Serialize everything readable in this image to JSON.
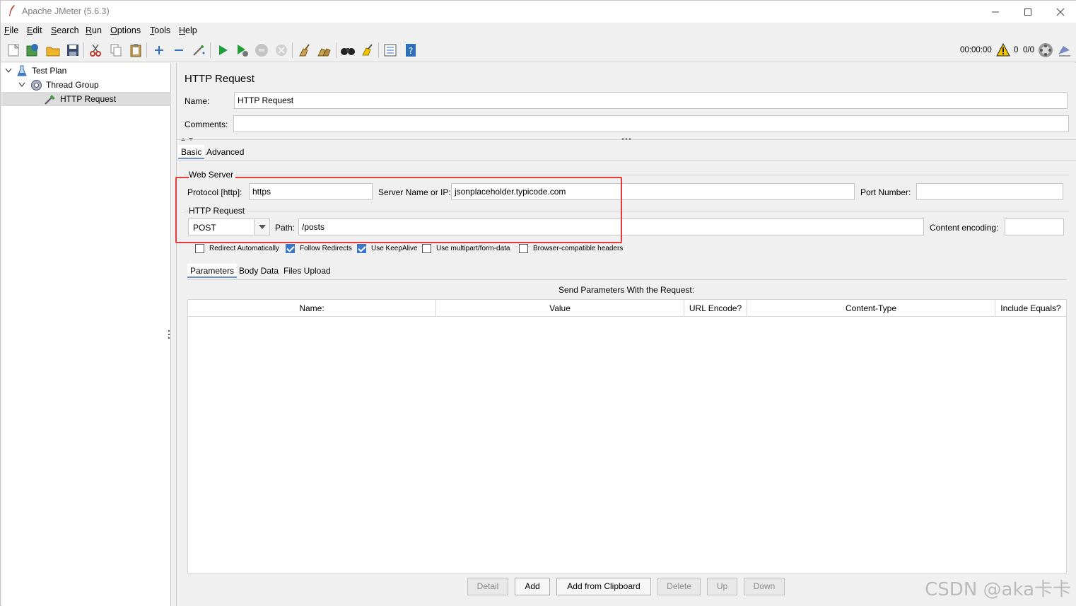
{
  "window": {
    "title": "Apache JMeter (5.6.3)"
  },
  "menu": [
    "File",
    "Edit",
    "Search",
    "Run",
    "Options",
    "Tools",
    "Help"
  ],
  "menu_mnemonics": [
    "F",
    "E",
    "S",
    "R",
    "O",
    "T",
    "H"
  ],
  "status": {
    "timer": "00:00:00",
    "warnings": "0",
    "threads": "0/0"
  },
  "tree": {
    "items": [
      {
        "label": "Test Plan",
        "icon": "beaker-icon"
      },
      {
        "label": "Thread Group",
        "icon": "gear-icon"
      },
      {
        "label": "HTTP Request",
        "icon": "pipette-icon"
      }
    ]
  },
  "panel": {
    "title": "HTTP Request",
    "name_label": "Name:",
    "name_value": "HTTP Request",
    "comments_label": "Comments:",
    "comments_value": "",
    "tabs": [
      "Basic",
      "Advanced"
    ],
    "web_server": {
      "legend": "Web Server",
      "protocol_label": "Protocol [http]:",
      "protocol_value": "https",
      "server_label": "Server Name or IP:",
      "server_value": "jsonplaceholder.typicode.com",
      "port_label": "Port Number:",
      "port_value": ""
    },
    "http_request": {
      "legend": "HTTP Request",
      "method": "POST",
      "path_label": "Path:",
      "path_value": "/posts",
      "encoding_label": "Content encoding:",
      "encoding_value": ""
    },
    "checkboxes": [
      {
        "label": "Redirect Automatically",
        "checked": false
      },
      {
        "label": "Follow Redirects",
        "checked": true
      },
      {
        "label": "Use KeepAlive",
        "checked": true
      },
      {
        "label": "Use multipart/form-data",
        "checked": false
      },
      {
        "label": "Browser-compatible headers",
        "checked": false
      }
    ],
    "subtabs": [
      "Parameters",
      "Body Data",
      "Files Upload"
    ],
    "params_caption": "Send Parameters With the Request:",
    "columns": [
      "Name:",
      "Value",
      "URL Encode?",
      "Content-Type",
      "Include Equals?"
    ],
    "buttons": [
      {
        "label": "Detail",
        "enabled": false
      },
      {
        "label": "Add",
        "enabled": true
      },
      {
        "label": "Add from Clipboard",
        "enabled": true
      },
      {
        "label": "Delete",
        "enabled": false
      },
      {
        "label": "Up",
        "enabled": false
      },
      {
        "label": "Down",
        "enabled": false
      }
    ]
  },
  "watermark": "CSDN @aka卡卡",
  "colors": {
    "highlight": "#e53a3a",
    "selection": "#dcdcdc",
    "accent": "#3c78c8"
  }
}
